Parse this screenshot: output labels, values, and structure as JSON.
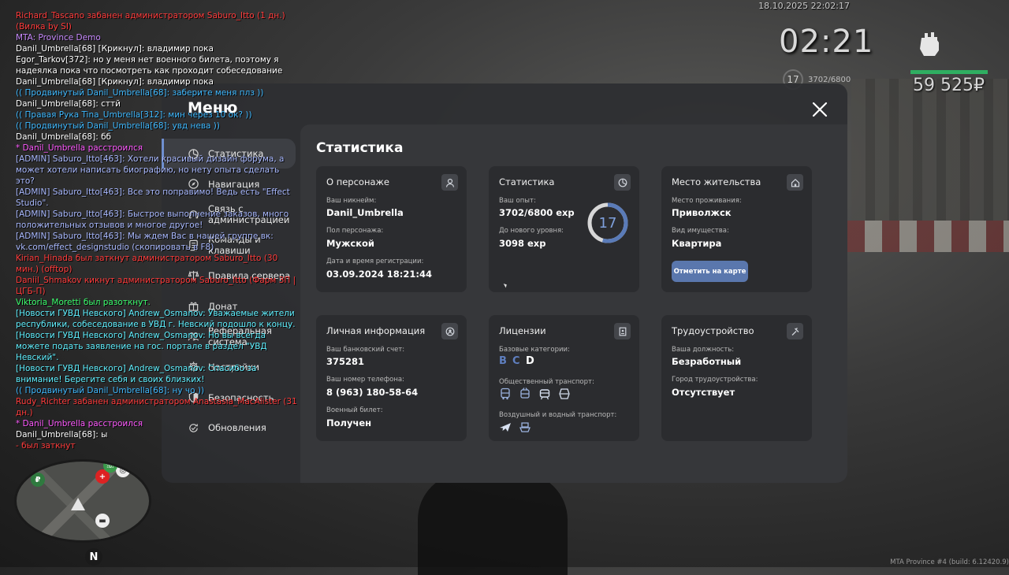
{
  "hud": {
    "datetime": "18.10.2025 22:02:17",
    "clock": "02:21",
    "level": "17",
    "exp": "3702/6800",
    "money": "59 525₽",
    "health_fraction": 1.0,
    "build": "MTA Province #4 (build: 6.12420.9)"
  },
  "chat": [
    {
      "text": "Richard_Tascano забанен администратором Saburo_Itto (1 дн.) (Вилка by SI)",
      "color": "#ff3c3c"
    },
    {
      "text": "MTA: Province Demo",
      "color": "#c98bff"
    },
    {
      "text": "Danil_Umbrella[68] [Крикнул]: владимир пока",
      "color": "#ffffff"
    },
    {
      "text": "Egor_Tarkov[372]: но у меня нет военного билета, поэтому я надеялка пока что посмотреть как проходит собеседование",
      "color": "#ffffff"
    },
    {
      "text": "Danil_Umbrella[68] [Крикнул]: владимир пока",
      "color": "#ffffff"
    },
    {
      "text": "(( Продвинутый Danil_Umbrella[68]: заберите меня плз ))",
      "color": "#3fb9ff"
    },
    {
      "text": "Danil_Umbrella[68]: сттй",
      "color": "#ffffff"
    },
    {
      "text": "(( Правая Рука Tina_Umbrella[312]: мин через 10 ок? ))",
      "color": "#3fb9ff"
    },
    {
      "text": "(( Продвинутый Danil_Umbrella[68]: увд нева ))",
      "color": "#3fb9ff"
    },
    {
      "text": "Danil_Umbrella[68]: бб",
      "color": "#ffffff"
    },
    {
      "text": "* Danil_Umbrella расстроился",
      "color": "#ff5aff"
    },
    {
      "text": "[ADMIN] Saburo_Itto[463]: Хотели красивый дизайн форума, а может хотели написать биографию, но нету опыта сделать это?",
      "color": "#a9b9ff"
    },
    {
      "text": "[ADMIN] Saburo_Itto[463]: Все это поправимо! Ведь есть \"Effect Studio\".",
      "color": "#a9b9ff"
    },
    {
      "text": "[ADMIN] Saburo_Itto[463]: Быстрое выполнение заказов, много положительных отзывов и многое другое!",
      "color": "#a9b9ff"
    },
    {
      "text": "[ADMIN] Saburo_Itto[463]: Мы ждем Вас в нашей группе вк: vk.com/effect_designstudio (скопировать в F8)",
      "color": "#a9b9ff"
    },
    {
      "text": "Kirian_Hinada был заткнут администратором Saburo_Itto (30 мин.) (offtop)",
      "color": "#ff3c3c"
    },
    {
      "text": "Daniil_Shmakov кикнут администратором Saburo_Itto (Фарм ЗП | ЦГБ-П)",
      "color": "#ff3c3c"
    },
    {
      "text": "Viktoria_Moretti был разоткнут.",
      "color": "#3cff6e"
    },
    {
      "text": "[Новости ГУВД Невского] Andrew_Osmanov: Уважаемые жители республики, собеседование в УВД г. Невский подошло к концу.",
      "color": "#5ff0ff"
    },
    {
      "text": "[Новости ГУВД Невского] Andrew_Osmanov: Но вы всегда можете подать заявление на гос. портале в раздел \"УВД Невский\".",
      "color": "#5ff0ff"
    },
    {
      "text": "[Новости ГУВД Невского] Andrew_Osmanov: Спасибо за внимание! Берегите себя и своих близких!",
      "color": "#5ff0ff"
    },
    {
      "text": "(( Продвинутый Danil_Umbrella[68]: ну чо ))",
      "color": "#3fb9ff"
    },
    {
      "text": "Rudy_Richter забанен администратором Anastasia_MacAlister (31 дн.)",
      "color": "#ff3c3c"
    },
    {
      "text": "* Danil_Umbrella расстроился",
      "color": "#ff5aff"
    },
    {
      "text": "Danil_Umbrella[68]: ы",
      "color": "#ffffff"
    },
    {
      "text": "- был заткнут",
      "color": "#ff3c3c"
    }
  ],
  "menu": {
    "title": "Меню",
    "sidebar": [
      {
        "label": "Статистика",
        "icon": "chart-pie-icon",
        "active": true
      },
      {
        "label": "Навигация",
        "icon": "compass-icon",
        "active": false
      },
      {
        "label": "Связь с администрацией",
        "icon": "headset-icon",
        "active": false
      },
      {
        "label": "Команды и клавиши",
        "icon": "keyboard-icon",
        "active": false
      },
      {
        "label": "Правила сервера",
        "icon": "scales-icon",
        "active": false
      },
      {
        "label": "Донат",
        "icon": "gift-icon",
        "active": false
      },
      {
        "label": "Реферальная система",
        "icon": "people-icon",
        "active": false
      },
      {
        "label": "Настройки",
        "icon": "gear-icon",
        "active": false
      },
      {
        "label": "Безопасность",
        "icon": "shield-icon",
        "active": false
      },
      {
        "label": "Обновления",
        "icon": "refresh-icon",
        "active": false
      }
    ],
    "content_title": "Статистика",
    "cards": {
      "character": {
        "title": "О персонаже",
        "nickname_label": "Ваш никнейм:",
        "nickname": "Danil_Umbrella",
        "gender_label": "Пол персонажа:",
        "gender": "Мужской",
        "reg_label": "Дата и время регистрации:",
        "reg": "03.09.2024 18:21:44"
      },
      "stats": {
        "title": "Статистика",
        "exp_label": "Ваш опыт:",
        "exp": "3702/6800 exp",
        "next_label": "До нового уровня:",
        "next": "3098 exp",
        "level": "17",
        "progress": 0.544
      },
      "residence": {
        "title": "Место жительства",
        "place_label": "Место проживания:",
        "place": "Приволжск",
        "property_label": "Вид имущества:",
        "property": "Квартира",
        "button": "Отметить на карте"
      },
      "personal": {
        "title": "Личная информация",
        "bank_label": "Ваш банковский счет:",
        "bank": "375281",
        "phone_label": "Ваш номер телефона:",
        "phone": "8 (963) 180-58-64",
        "military_label": "Военный билет:",
        "military": "Получен"
      },
      "licenses": {
        "title": "Лицензии",
        "base_label": "Базовые категории:",
        "categories": [
          {
            "label": "B",
            "color": "#5f7fc0"
          },
          {
            "label": "C",
            "color": "#5f7fc0"
          },
          {
            "label": "D",
            "color": "#ffffff"
          }
        ],
        "public_label": "Общественный транспорт:",
        "air_label": "Воздушный и водный транспорт:"
      },
      "employment": {
        "title": "Трудоустройство",
        "position_label": "Ваша должность:",
        "position": "Безработный",
        "city_label": "Город трудоустройства:",
        "city": "Отсутствует"
      }
    }
  }
}
